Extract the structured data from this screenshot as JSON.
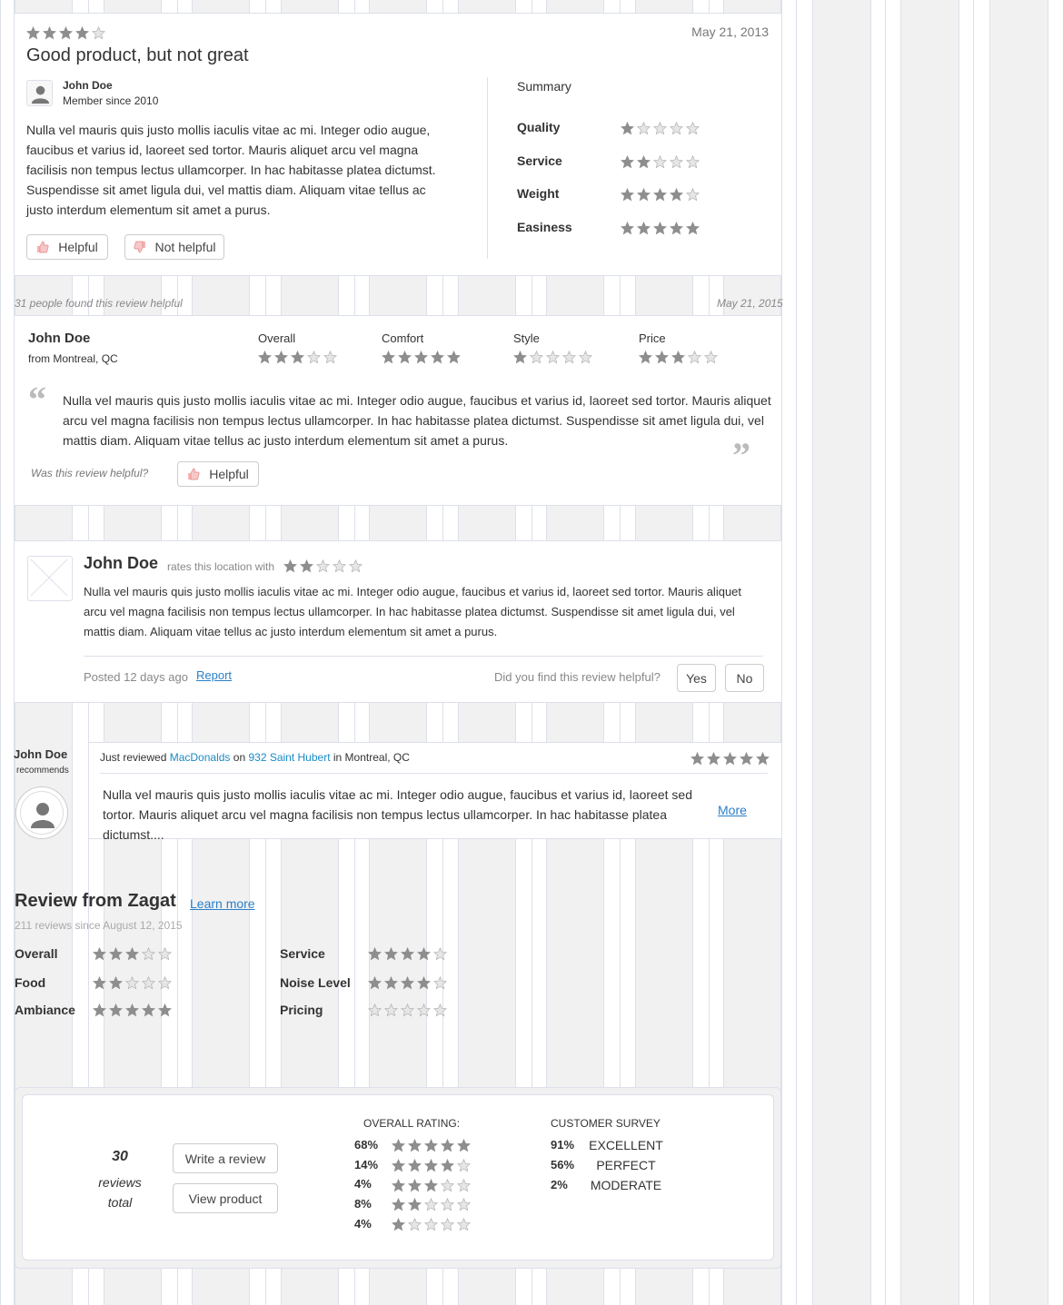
{
  "review1": {
    "rating": 4,
    "date": "May 21, 2013",
    "title": "Good product, but not great",
    "author": "John Doe",
    "member_since": "Member since 2010",
    "body": "Nulla vel mauris quis justo mollis iaculis vitae ac mi. Integer odio augue, faucibus et varius id, laoreet sed tortor. Mauris aliquet arcu vel magna facilisis non tempus lectus ullamcorper. In hac habitasse platea dictumst. Suspendisse sit amet ligula dui, vel mattis diam. Aliquam vitae tellus ac justo interdum elementum sit amet a purus.",
    "helpful_label": "Helpful",
    "not_helpful_label": "Not helpful",
    "summary_title": "Summary",
    "summary": [
      {
        "label": "Quality",
        "rating": 1
      },
      {
        "label": "Service",
        "rating": 2
      },
      {
        "label": "Weight",
        "rating": 4
      },
      {
        "label": "Easiness",
        "rating": 5
      }
    ]
  },
  "strip1": {
    "helpful_count_text": "31 people found this review helpful",
    "date": "May 21, 2015"
  },
  "review2": {
    "author": "John Doe",
    "location": "from Montreal, QC",
    "ratings": [
      {
        "label": "Overall",
        "rating": 3
      },
      {
        "label": "Comfort",
        "rating": 5
      },
      {
        "label": "Style",
        "rating": 1
      },
      {
        "label": "Price",
        "rating": 3
      }
    ],
    "body": "Nulla vel mauris quis justo mollis iaculis vitae ac mi. Integer odio augue, faucibus et varius id, laoreet sed tortor. Mauris aliquet arcu vel magna facilisis non tempus lectus ullamcorper. In hac habitasse platea dictumst. Suspendisse sit amet ligula dui, vel mattis diam. Aliquam vitae tellus ac justo interdum elementum sit amet a purus.",
    "helpful_question": "Was this review helpful?",
    "helpful_label": "Helpful"
  },
  "review3": {
    "author": "John Doe",
    "rates_text": "rates this location with",
    "rating": 2,
    "body": "Nulla vel mauris quis justo mollis iaculis vitae ac mi. Integer odio augue, faucibus et varius id, laoreet sed tortor. Mauris aliquet arcu vel magna facilisis non tempus lectus ullamcorper. In hac habitasse platea dictumst. Suspendisse sit amet ligula dui, vel mattis diam. Aliquam vitae tellus ac justo interdum elementum sit amet a purus.",
    "posted": "Posted 12 days ago",
    "report_label": "Report",
    "helpful_question": "Did you find this review helpful?",
    "yes_label": "Yes",
    "no_label": "No"
  },
  "review4": {
    "author": "John Doe",
    "recommends": "recommends",
    "just_reviewed": "Just reviewed",
    "place": "MacDonalds",
    "on": "on",
    "address": "932 Saint Hubert",
    "in_city": "in Montreal, QC",
    "rating": 5,
    "body": "Nulla vel mauris quis justo mollis iaculis vitae ac mi. Integer odio augue, faucibus et varius id, laoreet sed tortor. Mauris aliquet arcu vel magna facilisis non tempus lectus ullamcorper. In hac habitasse platea dictumst....",
    "more_label": "More"
  },
  "zagat": {
    "title": "Review from Zagat",
    "learn_more": "Learn more",
    "subtitle": "211 reviews since August 12, 2015",
    "left": [
      {
        "label": "Overall",
        "rating": 3
      },
      {
        "label": "Food",
        "rating": 2
      },
      {
        "label": "Ambiance",
        "rating": 5
      }
    ],
    "right": [
      {
        "label": "Service",
        "rating": 4
      },
      {
        "label": "Noise Level",
        "rating": 4
      },
      {
        "label": "Pricing",
        "rating": 0
      }
    ]
  },
  "summary_box": {
    "total_count": "30",
    "total_label_1": "reviews",
    "total_label_2": "total",
    "write_review": "Write a review",
    "view_product": "View product",
    "overall_title": "OVERALL RATING:",
    "overall": [
      {
        "percent": "68%",
        "stars": 5
      },
      {
        "percent": "14%",
        "stars": 4
      },
      {
        "percent": "4%",
        "stars": 3
      },
      {
        "percent": "8%",
        "stars": 2
      },
      {
        "percent": "4%",
        "stars": 1
      }
    ],
    "survey_title": "CUSTOMER SURVEY",
    "survey": [
      {
        "percent": "91%",
        "label": "EXCELLENT"
      },
      {
        "percent": "56%",
        "label": "PERFECT"
      },
      {
        "percent": "2%",
        "label": "MODERATE"
      }
    ]
  },
  "colors": {
    "star_filled": "#8e8e8e",
    "star_empty": "#dcdcdc",
    "link": "#2a7fc9",
    "grid_gray": "#f1f1f1",
    "grid_line": "#dde0ea"
  }
}
